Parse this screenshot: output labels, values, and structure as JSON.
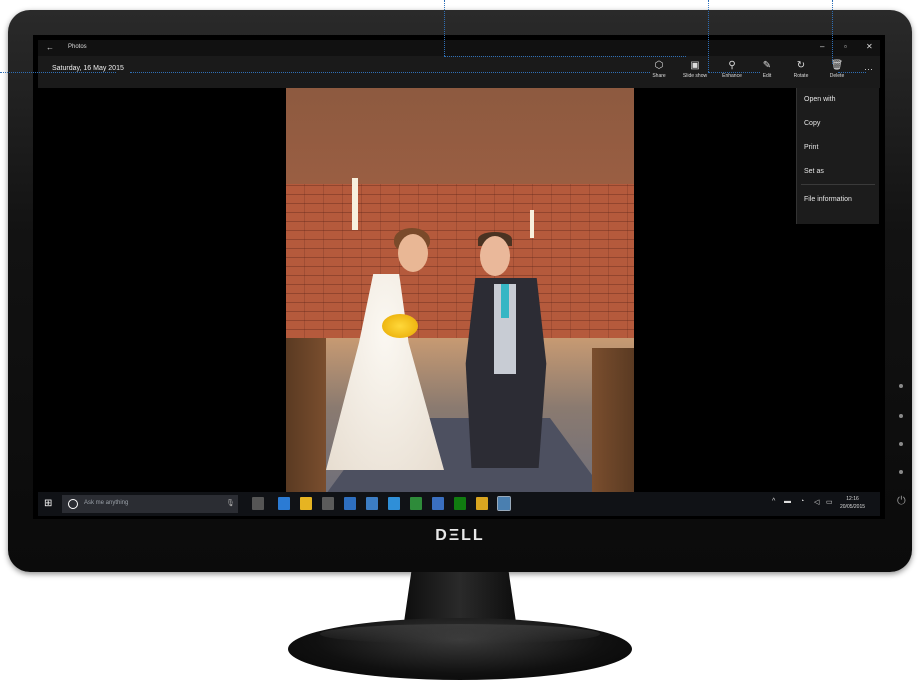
{
  "monitor": {
    "brand": "DΞLL"
  },
  "app": {
    "title": "Photos",
    "date": "Saturday, 16 May 2015"
  },
  "commands": [
    {
      "label": "Share",
      "icon": "share-icon"
    },
    {
      "label": "Slide show",
      "icon": "slideshow-icon"
    },
    {
      "label": "Enhance",
      "icon": "enhance-icon"
    },
    {
      "label": "Edit",
      "icon": "edit-icon"
    },
    {
      "label": "Rotate",
      "icon": "rotate-icon"
    },
    {
      "label": "Delete",
      "icon": "delete-icon"
    }
  ],
  "menu": [
    {
      "label": "Open with"
    },
    {
      "label": "Copy"
    },
    {
      "label": "Print"
    },
    {
      "label": "Set as"
    },
    {
      "label": "File information"
    }
  ],
  "taskbar": {
    "search_placeholder": "Ask me anything",
    "clock_time": "12:16",
    "clock_date": "20/05/2015"
  },
  "colors": {
    "callout": "#2f6fb5",
    "accent": "#36b6c4"
  }
}
